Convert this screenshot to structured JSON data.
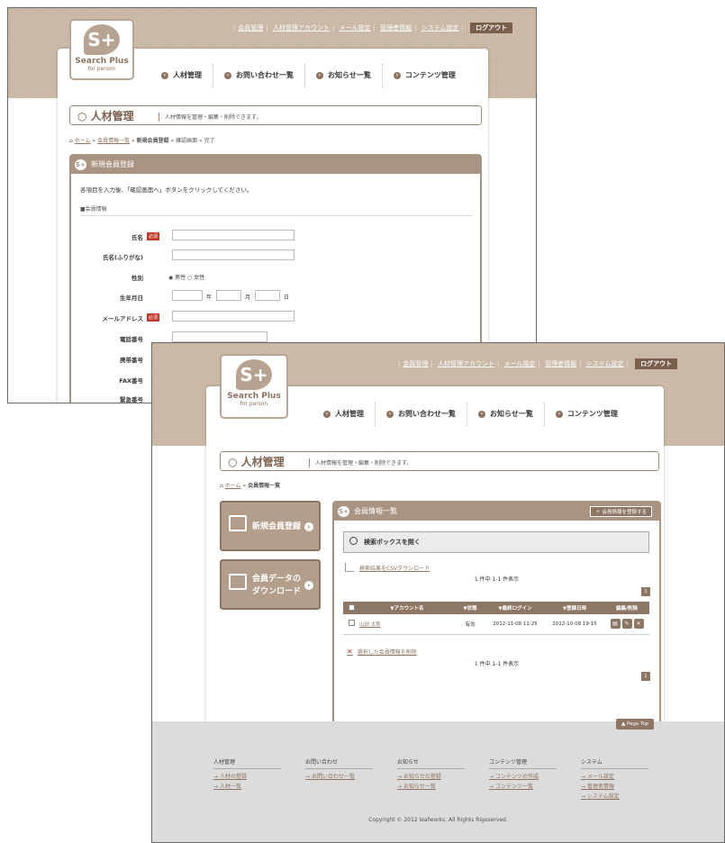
{
  "header": {
    "top_links": [
      "会員管理",
      "人材管理アカウント",
      "メール設定",
      "管理者情報",
      "システム設定"
    ],
    "logout": "ログアウト",
    "logo_mark": "S+",
    "logo_title": "Search Plus",
    "logo_sub": "for person",
    "nav": [
      "人材管理",
      "お問い合わせ一覧",
      "お知らせ一覧",
      "コンテンツ管理"
    ]
  },
  "page": {
    "title": "人材管理",
    "description": "人材情報を管理・編集・削除できます。"
  },
  "screen1": {
    "breadcrumb": [
      "ホーム",
      "会員情報一覧",
      "新規会員登録",
      "確認画面",
      "完了"
    ],
    "panel_title": "新規会員登録",
    "intro": "各項目を入力後、「確認画面へ」ボタンをクリックしてください。",
    "section": "■会員情報",
    "required": "必須",
    "fields": [
      "氏名",
      "氏名(ふりがな)",
      "性別",
      "生年月日",
      "メールアドレス",
      "電話番号",
      "携帯番号",
      "FAX番号",
      "緊急番号"
    ],
    "gender_options": "◉ 男性  ○ 女性",
    "date_units": [
      "年",
      "月",
      "日"
    ]
  },
  "screen2": {
    "breadcrumb": [
      "ホーム",
      "会員情報一覧"
    ],
    "side_buttons": [
      {
        "line1": "新規会員登録",
        "line2": ""
      },
      {
        "line1": "会員データの",
        "line2": "ダウンロード"
      }
    ],
    "panel_title": "会員情報一覧",
    "register_button": "会員情報を登録する",
    "search_toggle": "検索ボックスを開く",
    "csv_link": "検索結果をCSVダウンロード",
    "count": "1 件中 1-1 件表示",
    "pager": "1",
    "table": {
      "headers": [
        "▼アカウント名",
        "▼状態",
        "▼最終ログイン",
        "▼登録日時",
        "編集/削除"
      ],
      "rows": [
        {
          "name": "山田 太郎",
          "status": "有効",
          "last_login": "2012-11-08 11:25",
          "registered": "2012-10-08 19:15"
        }
      ]
    },
    "delete_link": "選択した会員情報を削除",
    "page_top": "▲ Page Top",
    "footer": [
      {
        "heading": "人材管理",
        "items": [
          "人材の登録",
          "人材一覧"
        ]
      },
      {
        "heading": "お問い合わせ",
        "items": [
          "お問い合わせ一覧"
        ]
      },
      {
        "heading": "お知らせ",
        "items": [
          "お知らせの登録",
          "お知らせ一覧"
        ]
      },
      {
        "heading": "コンテンツ管理",
        "items": [
          "コンテンツの作成",
          "コンテンツ一覧"
        ]
      },
      {
        "heading": "システム",
        "items": [
          "メール設定",
          "管理者情報",
          "システム設定"
        ]
      }
    ],
    "copyright": "Copyright © 2012 leafworks. All Rights Rigeserved."
  },
  "colors": {
    "brand_brown": "#a99483",
    "accent_dark": "#8e7665",
    "required_red": "#c0392b",
    "header_band": "#c9b6a4"
  }
}
